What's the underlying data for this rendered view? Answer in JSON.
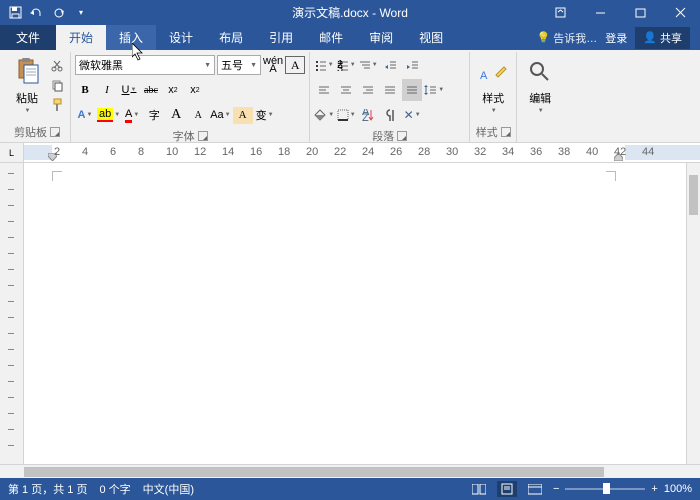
{
  "title": "演示文稿.docx - Word",
  "tabs": {
    "file": "文件",
    "home": "开始",
    "insert": "插入",
    "design": "设计",
    "layout": "布局",
    "references": "引用",
    "mail": "邮件",
    "review": "审阅",
    "view": "视图"
  },
  "tell_me": "告诉我…",
  "login": "登录",
  "share": "共享",
  "font": {
    "name": "微软雅黑",
    "size": "五号",
    "wen": "wén",
    "a1": "A",
    "bold": "B",
    "italic": "I",
    "underline": "U",
    "strike": "abc",
    "sub": "x",
    "sup": "x",
    "afx": "A",
    "hl": "ab",
    "acolor": "A",
    "circle": "字",
    "aa_big": "A",
    "aa_small": "A",
    "aa1": "Aa",
    "clearfmt": "A",
    "phonetic": "变"
  },
  "groups": {
    "clipboard": "剪贴板",
    "font": "字体",
    "paragraph": "段落",
    "styles": "样式",
    "editing": "编辑"
  },
  "clipboard": {
    "paste": "粘贴"
  },
  "styles": {
    "label": "样式"
  },
  "ruler_marks": [
    "2",
    "4",
    "6",
    "8",
    "10",
    "12",
    "14",
    "16",
    "18",
    "20",
    "22",
    "24",
    "26",
    "28",
    "30",
    "32",
    "34",
    "36",
    "38",
    "40",
    "42",
    "44"
  ],
  "status": {
    "page": "第 1 页，共 1 页",
    "words": "0 个字",
    "lang": "中文(中国)",
    "zoom": "100%"
  }
}
